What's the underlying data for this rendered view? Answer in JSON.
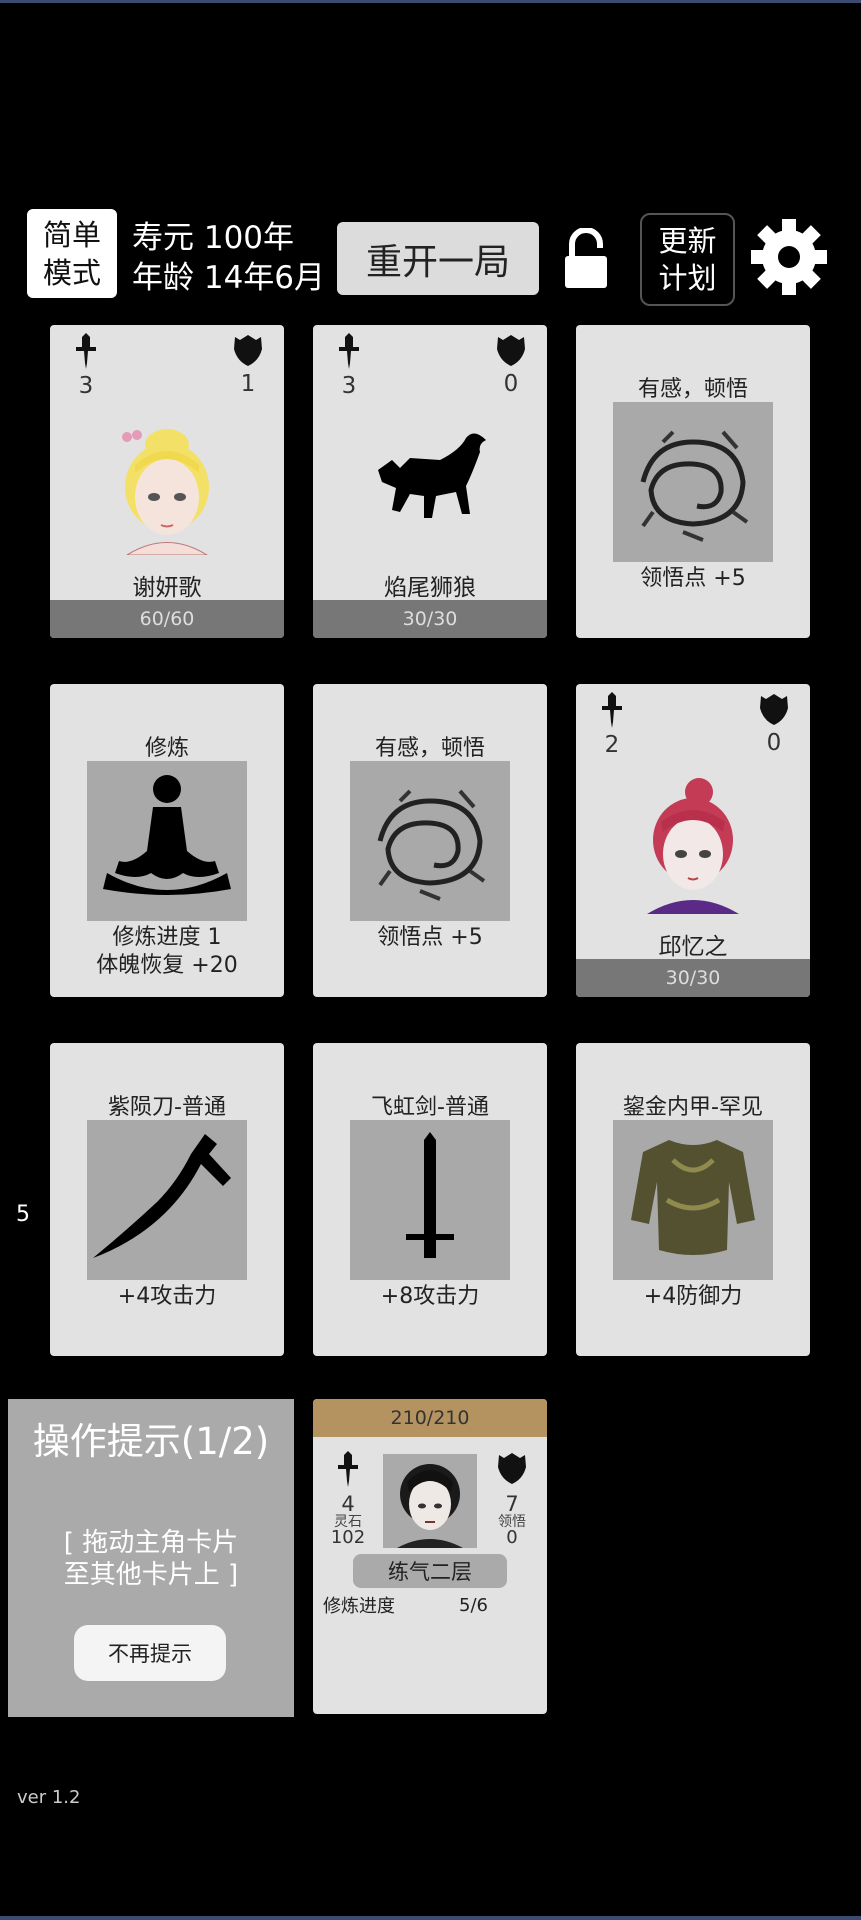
{
  "header": {
    "mode_label": "简单模式",
    "lifespan": "寿元 100年",
    "age": "年龄 14年6月",
    "restart_label": "重开一局",
    "plan_label": "更新计划"
  },
  "cards": [
    {
      "atk": "3",
      "def": "1",
      "name": "谢妍歌",
      "hp": "60/60"
    },
    {
      "atk": "3",
      "def": "0",
      "name": "焰尾狮狼",
      "hp": "30/30"
    },
    {
      "title": "有感，顿悟",
      "desc": "领悟点  +5"
    },
    {
      "title": "修炼",
      "desc1": "修炼进度  1",
      "desc2": "体魄恢复  +20"
    },
    {
      "title": "有感，顿悟",
      "desc": "领悟点  +5"
    },
    {
      "atk": "2",
      "def": "0",
      "name": "邱忆之",
      "hp": "30/30"
    },
    {
      "title": "紫陨刀-普通",
      "desc": "+4攻击力"
    },
    {
      "title": "飞虹剑-普通",
      "desc": "+8攻击力"
    },
    {
      "title": "鋆金内甲-罕见",
      "desc": "+4防御力"
    }
  ],
  "side_number": "5",
  "hint": {
    "title": "操作提示(1/2)",
    "line1": "[ 拖动主角卡片",
    "line2": "至其他卡片上 ]",
    "dismiss_label": "不再提示"
  },
  "player": {
    "hp": "210/210",
    "atk": "4",
    "spirit_stone_label": "灵石",
    "spirit_stone": "102",
    "def": "7",
    "insight_label": "领悟",
    "insight": "0",
    "realm": "练气二层",
    "progress_label": "修炼进度",
    "progress": "5/6"
  },
  "version": "ver 1.2",
  "colors": {
    "background": "#000000",
    "card": "#e2e2e2",
    "hp_bar": "#777777",
    "player_hp_bar": "#b59361",
    "art_bg": "#a9a9a9"
  }
}
